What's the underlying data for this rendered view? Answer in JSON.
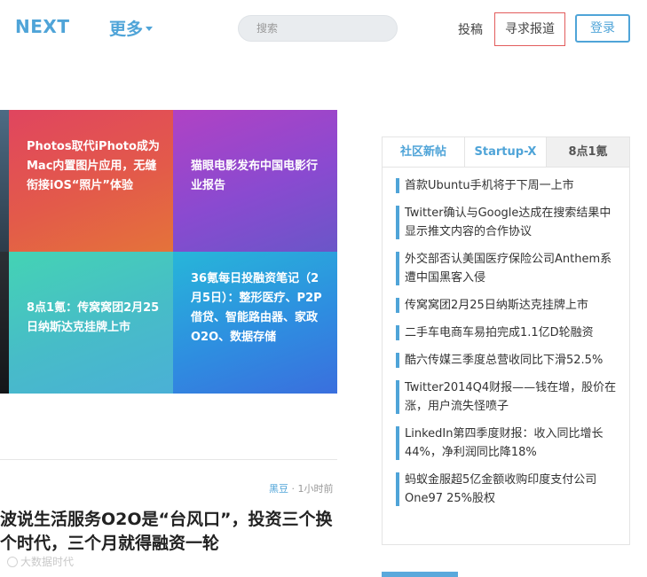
{
  "header": {
    "logo": "NEXT",
    "more_label": "更多",
    "search_placeholder": "搜索",
    "contribute_label": "投稿",
    "report_label": "寻求报道",
    "login_label": "登录"
  },
  "tiles": [
    {
      "text": "Photos取代iPhoto成为Mac内置图片应用，无缝衔接iOS“照片”体验"
    },
    {
      "text": "猫眼电影发布中国电影行业报告"
    },
    {
      "text": "8点1氪：传窝窝团2月25日纳斯达克挂牌上市"
    },
    {
      "text": "36氪每日投融资笔记（2月5日）：整形医疗、P2P借贷、智能路由器、家政O2O、数据存储"
    }
  ],
  "article": {
    "author": "黑豆",
    "time": "· 1小时前",
    "title": "波说生活服务O2O是“台风口”，投资三个换个时代，三个月就得融资一轮"
  },
  "watermark": "大数据时代",
  "sidebar": {
    "tabs": [
      "社区新帖",
      "Startup-X",
      "8点1氪"
    ],
    "items": [
      "首款Ubuntu手机将于下周一上市",
      "Twitter确认与Google达成在搜索结果中显示推文内容的合作协议",
      "外交部否认美国医疗保险公司Anthem系遭中国黑客入侵",
      "传窝窝团2月25日纳斯达克挂牌上市",
      "二手车电商车易拍完成1.1亿D轮融资",
      "酷六传媒三季度总营收同比下滑52.5%",
      "Twitter2014Q4财报——钱在增，股价在涨，用户流失怪喷子",
      "LinkedIn第四季度财报：收入同比增长44%，净利润同比降18%",
      "蚂蚁金服超5亿金额收购印度支付公司One97 25%股权"
    ]
  },
  "colors": {
    "brand": "#4fa4d8",
    "report_border": "#e25c5c"
  }
}
